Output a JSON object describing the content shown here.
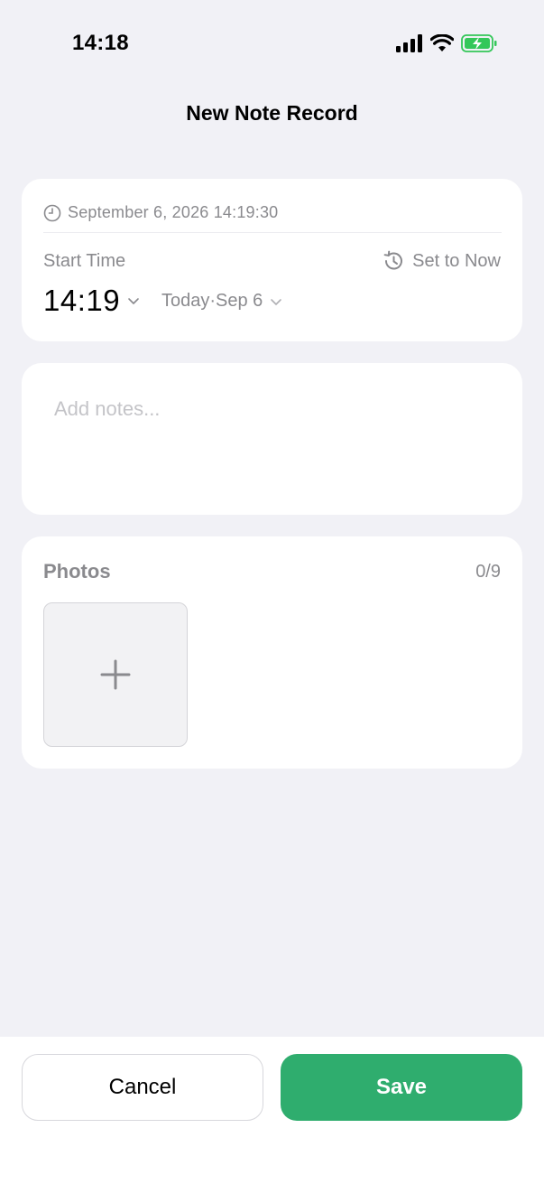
{
  "status_bar": {
    "time": "14:18",
    "icons": [
      "signal-icon",
      "wifi-icon",
      "battery-charging-icon"
    ],
    "battery_color": "#34c759"
  },
  "nav": {
    "title": "New Note Record"
  },
  "time_card": {
    "recorded_at": "September 6, 2026 14:19:30",
    "start_label": "Start Time",
    "set_now_label": "Set to Now",
    "time_value": "14:19",
    "date_value": "Today·Sep 6"
  },
  "notes": {
    "placeholder": "Add notes...",
    "value": ""
  },
  "photos": {
    "title": "Photos",
    "count": "0/9"
  },
  "actions": {
    "cancel_label": "Cancel",
    "save_label": "Save"
  },
  "colors": {
    "background": "#f1f1f6",
    "card": "#ffffff",
    "secondary_text": "#8a8a8e",
    "accent": "#2fad6e"
  }
}
